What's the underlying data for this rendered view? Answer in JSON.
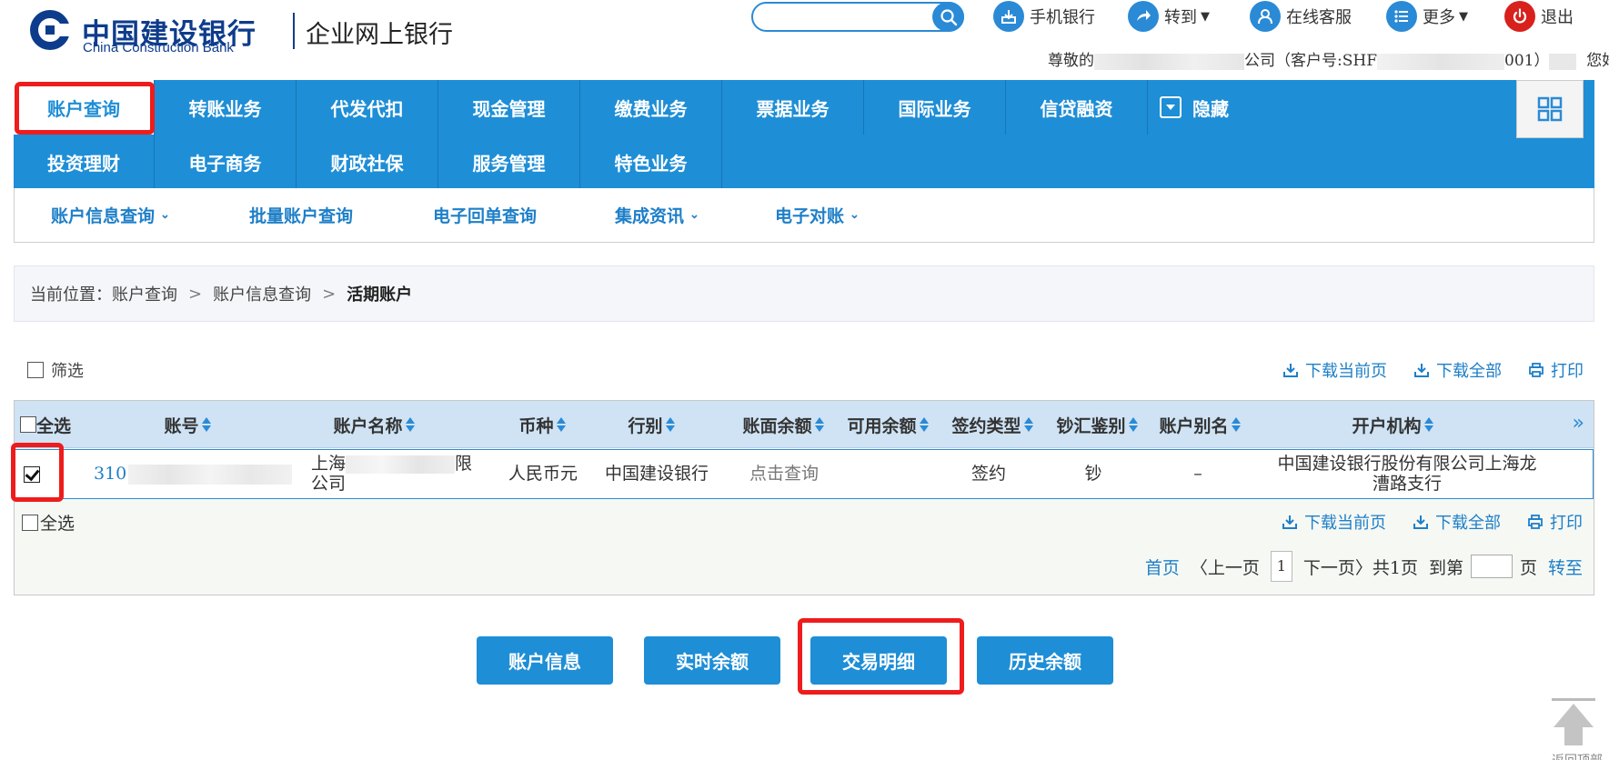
{
  "brand": {
    "name_cn": "中国建设银行",
    "name_en": "China Construction Bank",
    "product": "企业网上银行"
  },
  "search": {
    "value": "",
    "placeholder": ""
  },
  "top_links": [
    {
      "label": "手机银行",
      "icon": "mobile-bank-icon"
    },
    {
      "label": "转到",
      "icon": "goto-icon",
      "dropdown": true
    },
    {
      "label": "在线客服",
      "icon": "customer-service-icon"
    },
    {
      "label": "更多",
      "icon": "more-list-icon",
      "dropdown": true
    },
    {
      "label": "退出",
      "icon": "power-icon"
    }
  ],
  "welcome": {
    "prefix": "尊敬的",
    "mid": "公司（客户号:SHF",
    "mid2": "001）",
    "suffix": "您好!"
  },
  "main_nav": {
    "row1": [
      "账户查询",
      "转账业务",
      "代发代扣",
      "现金管理",
      "缴费业务",
      "票据业务",
      "国际业务",
      "信贷融资"
    ],
    "row2": [
      "投资理财",
      "电子商务",
      "财政社保",
      "服务管理",
      "特色业务"
    ],
    "hide_label": "隐藏",
    "active": "账户查询"
  },
  "sub_nav": [
    {
      "label": "账户信息查询",
      "dropdown": true
    },
    {
      "label": "批量账户查询",
      "dropdown": false
    },
    {
      "label": "电子回单查询",
      "dropdown": false
    },
    {
      "label": "集成资讯",
      "dropdown": true
    },
    {
      "label": "电子对账",
      "dropdown": true
    }
  ],
  "breadcrumb": {
    "prefix": "当前位置：",
    "items": [
      "账户查询",
      "账户信息查询",
      "活期账户"
    ]
  },
  "filter": {
    "label": "筛选"
  },
  "downloads": {
    "current_page": "下载当前页",
    "all": "下载全部",
    "print": "打印"
  },
  "table": {
    "select_all": "全选",
    "columns": [
      "账号",
      "账户名称",
      "币种",
      "行别",
      "账面余额",
      "可用余额",
      "签约类型",
      "钞汇鉴别",
      "账户别名",
      "开户机构"
    ],
    "more": "»",
    "rows": [
      {
        "checked": true,
        "account_no": "310",
        "account_name_1": "上海",
        "account_name_2": "限",
        "account_name_3": "公司",
        "currency": "人民币元",
        "bank": "中国建设银行",
        "book_balance": "点击查询",
        "available_balance": "",
        "sign_type": "签约",
        "cash_type": "钞",
        "alias": "–",
        "branch_1": "中国建设银行股份有限公司上海龙",
        "branch_2": "漕路支行"
      }
    ]
  },
  "pager": {
    "first": "首页",
    "prev": "〈上一页",
    "current": "1",
    "next": "下一页〉",
    "total": "共1页",
    "goto_prefix": "到第",
    "goto_suffix": "页",
    "go": "转至"
  },
  "actions": [
    "账户信息",
    "实时余额",
    "交易明细",
    "历史余额"
  ],
  "back_to_top": {
    "label": "返回顶部"
  },
  "colors": {
    "brand_blue": "#0e3c8c",
    "nav_blue": "#1e8ed6",
    "link_blue": "#1e7fc8",
    "highlight_red": "#ee1c1c",
    "exit_red": "#d8211c"
  }
}
